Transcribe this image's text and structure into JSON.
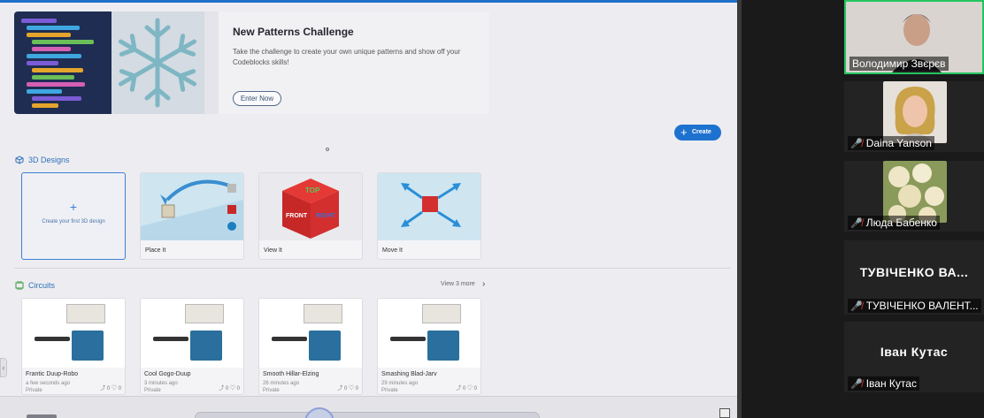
{
  "banner": {
    "title": "New Patterns Challenge",
    "description": "Take the challenge to create your own unique patterns and show off your Codeblocks skills!",
    "button": "Enter Now"
  },
  "create_button": "Create",
  "designs": {
    "heading": "3D Designs",
    "cards": [
      {
        "label": "Create your first 3D design"
      },
      {
        "label": "Place It"
      },
      {
        "label": "View It"
      },
      {
        "label": "Move It"
      }
    ],
    "cube_faces": {
      "top": "TOP",
      "front": "FRONT",
      "right": "RIGHT"
    }
  },
  "circuits": {
    "heading": "Circuits",
    "view_more": "View 3 more",
    "cards": [
      {
        "name": "Frantic Duup-Robo",
        "time": "a few seconds ago",
        "privacy": "Private",
        "views": "0",
        "likes": "0"
      },
      {
        "name": "Cool Gogo-Duup",
        "time": "3 minutes ago",
        "privacy": "Private",
        "views": "0",
        "likes": "0"
      },
      {
        "name": "Smooth Hillar-Elzing",
        "time": "26 minutes ago",
        "privacy": "Private",
        "views": "0",
        "likes": "0"
      },
      {
        "name": "Smashing Blad-Jarv",
        "time": "29 minutes ago",
        "privacy": "Private",
        "views": "0",
        "likes": "0"
      }
    ]
  },
  "participants": [
    {
      "name": "Володимир Звєрєв",
      "muted": false
    },
    {
      "name": "Daina Yanson",
      "muted": true
    },
    {
      "name": "Люда Бабенко",
      "muted": true
    },
    {
      "name": "ТУВІЧЕНКО ВАЛЕНТ...",
      "display": "ТУВІЧЕНКО ВА...",
      "muted": true
    },
    {
      "name": "Іван Кутас",
      "display": "Іван Кутас",
      "muted": true
    }
  ],
  "colors": {
    "accent": "#1e72cf",
    "active_speaker": "#22c55e",
    "muted": "#e53935"
  }
}
